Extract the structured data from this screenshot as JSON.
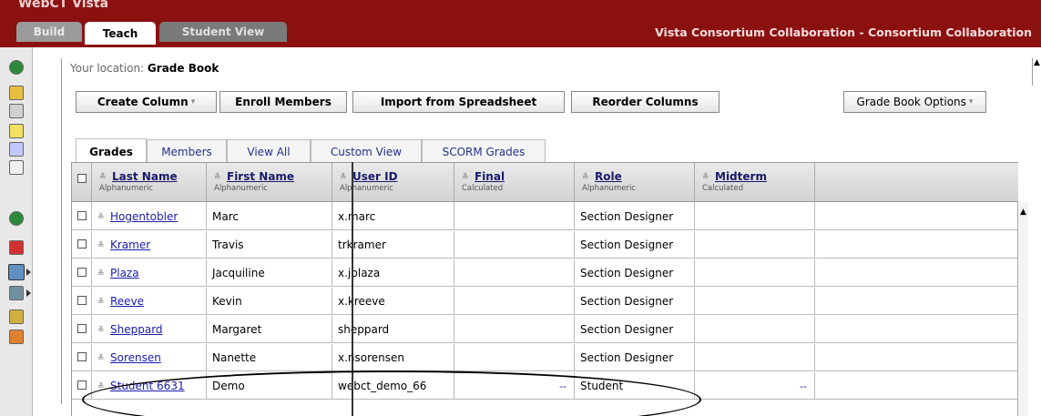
{
  "header": {
    "title_strip": "WebCT Vista",
    "tabs": [
      "Build",
      "Teach",
      "Student View"
    ],
    "right_title": "Vista Consortium Collaboration - Consortium Collaboration"
  },
  "location": {
    "label": "Your location:",
    "value": "Grade Book"
  },
  "toolbar": {
    "create_column": "Create Column",
    "enroll_members": "Enroll Members",
    "import_spreadsheet": "Import from Spreadsheet",
    "reorder_columns": "Reorder Columns",
    "grade_book_options": "Grade Book Options"
  },
  "subtabs": [
    "Grades",
    "Members",
    "View All",
    "Custom View",
    "SCORM Grades"
  ],
  "columns": [
    {
      "name": "Last Name",
      "type": "Alphanumeric"
    },
    {
      "name": "First Name",
      "type": "Alphanumeric"
    },
    {
      "name": "User ID",
      "type": "Alphanumeric"
    },
    {
      "name": "Final",
      "type": "Calculated"
    },
    {
      "name": "Role",
      "type": "Alphanumeric"
    },
    {
      "name": "Midterm",
      "type": "Calculated"
    }
  ],
  "rows": [
    {
      "last": "Hogentobler",
      "first": "Marc",
      "user": "x.marc",
      "final": "",
      "role": "Section Designer",
      "midterm": ""
    },
    {
      "last": "Kramer",
      "first": "Travis",
      "user": "trkramer",
      "final": "",
      "role": "Section Designer",
      "midterm": ""
    },
    {
      "last": "Plaza",
      "first": "Jacquiline",
      "user": "x.jplaza",
      "final": "",
      "role": "Section Designer",
      "midterm": ""
    },
    {
      "last": "Reeve",
      "first": "Kevin",
      "user": "x.kreeve",
      "final": "",
      "role": "Section Designer",
      "midterm": ""
    },
    {
      "last": "Sheppard",
      "first": "Margaret",
      "user": "sheppard",
      "final": "",
      "role": "Section Designer",
      "midterm": ""
    },
    {
      "last": "Sorensen",
      "first": "Nanette",
      "user": "x.nsorensen",
      "final": "",
      "role": "Section Designer",
      "midterm": ""
    },
    {
      "last": "Student 6631",
      "first": "Demo",
      "user": "webct_demo_66",
      "final": "--",
      "role": "Student",
      "midterm": "--"
    }
  ],
  "colors": {
    "header_bg": "#8b1010",
    "link": "#1a1aaa"
  }
}
